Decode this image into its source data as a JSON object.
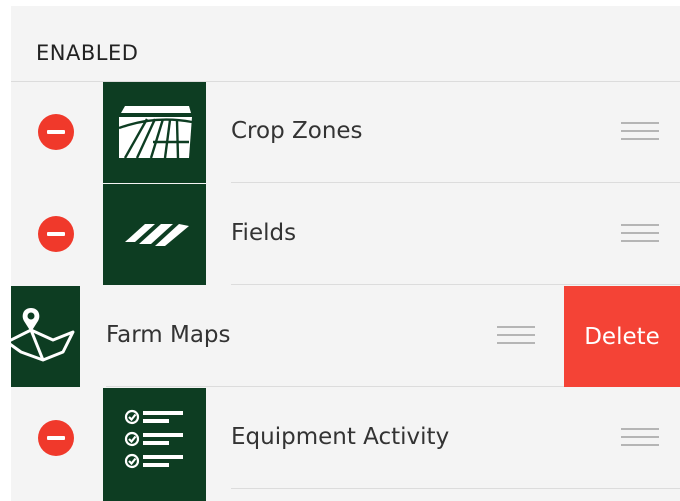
{
  "section": {
    "title": "ENABLED"
  },
  "rows": [
    {
      "label": "Crop Zones",
      "icon": "crop-zones-icon",
      "state": "enabled"
    },
    {
      "label": "Fields",
      "icon": "fields-icon",
      "state": "enabled"
    },
    {
      "label": "Farm Maps",
      "icon": "farm-maps-icon",
      "state": "swiped-open",
      "delete_label": "Delete"
    },
    {
      "label": "Equipment Activity",
      "icon": "equipment-activity-icon",
      "state": "enabled"
    }
  ],
  "colors": {
    "tile_background": "#0d3d22",
    "remove_button": "#f0392b",
    "delete_button": "#f44336",
    "panel_background": "#f4f4f4"
  }
}
